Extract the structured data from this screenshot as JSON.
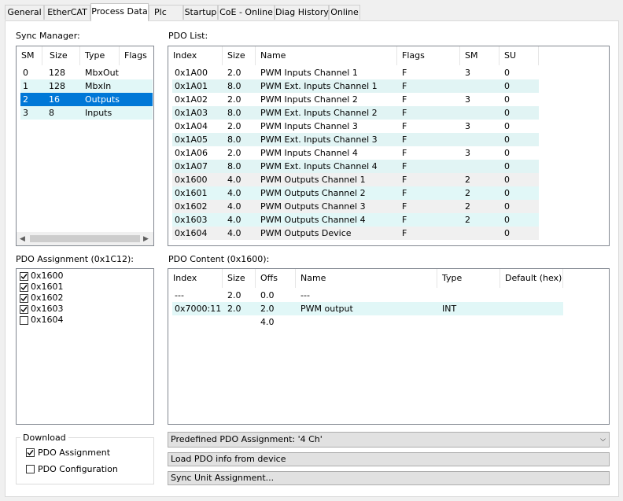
{
  "tabs": [
    "General",
    "EtherCAT",
    "Process Data",
    "Plc",
    "Startup",
    "CoE - Online",
    "Diag History",
    "Online"
  ],
  "active_tab": "Process Data",
  "sync_manager": {
    "label": "Sync Manager:",
    "columns": [
      "SM",
      "Size",
      "Type",
      "Flags"
    ],
    "rows": [
      {
        "sm": "0",
        "size": "128",
        "type": "MbxOut",
        "flags": ""
      },
      {
        "sm": "1",
        "size": "128",
        "type": "MbxIn",
        "flags": ""
      },
      {
        "sm": "2",
        "size": "16",
        "type": "Outputs",
        "flags": ""
      },
      {
        "sm": "3",
        "size": "8",
        "type": "Inputs",
        "flags": ""
      }
    ],
    "selected_index": 2
  },
  "pdo_list": {
    "label": "PDO List:",
    "columns": [
      "Index",
      "Size",
      "Name",
      "Flags",
      "SM",
      "SU"
    ],
    "rows": [
      {
        "index": "0x1A00",
        "size": "2.0",
        "name": "PWM Inputs Channel 1",
        "flags": "F",
        "sm": "3",
        "su": "0"
      },
      {
        "index": "0x1A01",
        "size": "8.0",
        "name": "PWM Ext. Inputs Channel 1",
        "flags": "F",
        "sm": "",
        "su": "0"
      },
      {
        "index": "0x1A02",
        "size": "2.0",
        "name": "PWM Inputs Channel 2",
        "flags": "F",
        "sm": "3",
        "su": "0"
      },
      {
        "index": "0x1A03",
        "size": "8.0",
        "name": "PWM Ext. Inputs Channel 2",
        "flags": "F",
        "sm": "",
        "su": "0"
      },
      {
        "index": "0x1A04",
        "size": "2.0",
        "name": "PWM Inputs Channel 3",
        "flags": "F",
        "sm": "3",
        "su": "0"
      },
      {
        "index": "0x1A05",
        "size": "8.0",
        "name": "PWM Ext. Inputs Channel 3",
        "flags": "F",
        "sm": "",
        "su": "0"
      },
      {
        "index": "0x1A06",
        "size": "2.0",
        "name": "PWM Inputs Channel 4",
        "flags": "F",
        "sm": "3",
        "su": "0"
      },
      {
        "index": "0x1A07",
        "size": "8.0",
        "name": "PWM Ext. Inputs Channel 4",
        "flags": "F",
        "sm": "",
        "su": "0"
      },
      {
        "index": "0x1600",
        "size": "4.0",
        "name": "PWM Outputs Channel 1",
        "flags": "F",
        "sm": "2",
        "su": "0"
      },
      {
        "index": "0x1601",
        "size": "4.0",
        "name": "PWM Outputs Channel 2",
        "flags": "F",
        "sm": "2",
        "su": "0"
      },
      {
        "index": "0x1602",
        "size": "4.0",
        "name": "PWM Outputs Channel 3",
        "flags": "F",
        "sm": "2",
        "su": "0"
      },
      {
        "index": "0x1603",
        "size": "4.0",
        "name": "PWM Outputs Channel 4",
        "flags": "F",
        "sm": "2",
        "su": "0"
      },
      {
        "index": "0x1604",
        "size": "4.0",
        "name": "PWM Outputs Device",
        "flags": "F",
        "sm": "",
        "su": "0"
      }
    ]
  },
  "pdo_assignment": {
    "label": "PDO Assignment (0x1C12):",
    "items": [
      {
        "label": "0x1600",
        "checked": true
      },
      {
        "label": "0x1601",
        "checked": true
      },
      {
        "label": "0x1602",
        "checked": true
      },
      {
        "label": "0x1603",
        "checked": true
      },
      {
        "label": "0x1604",
        "checked": false
      }
    ]
  },
  "pdo_content": {
    "label": "PDO Content (0x1600):",
    "columns": [
      "Index",
      "Size",
      "Offs",
      "Name",
      "Type",
      "Default (hex)"
    ],
    "rows": [
      {
        "index": "---",
        "size": "2.0",
        "offs": "0.0",
        "name": "---",
        "type": "",
        "default": ""
      },
      {
        "index": "0x7000:11",
        "size": "2.0",
        "offs": "2.0",
        "name": "PWM output",
        "type": "INT",
        "default": ""
      },
      {
        "index": "",
        "size": "",
        "offs": "4.0",
        "name": "",
        "type": "",
        "default": ""
      }
    ]
  },
  "download": {
    "label": "Download",
    "options": [
      {
        "label": "PDO Assignment",
        "checked": true
      },
      {
        "label": "PDO Configuration",
        "checked": false
      }
    ]
  },
  "predefined_select": {
    "value": "Predefined PDO Assignment: '4 Ch'"
  },
  "buttons": {
    "load_pdo": "Load PDO info from device",
    "sync_unit": "Sync Unit Assignment..."
  },
  "colors": {
    "row_alt": "#e1f7f7",
    "row_alt2": "#e6f2f2",
    "selected": "#0078d7",
    "gray_row": "#f0f0f0"
  }
}
